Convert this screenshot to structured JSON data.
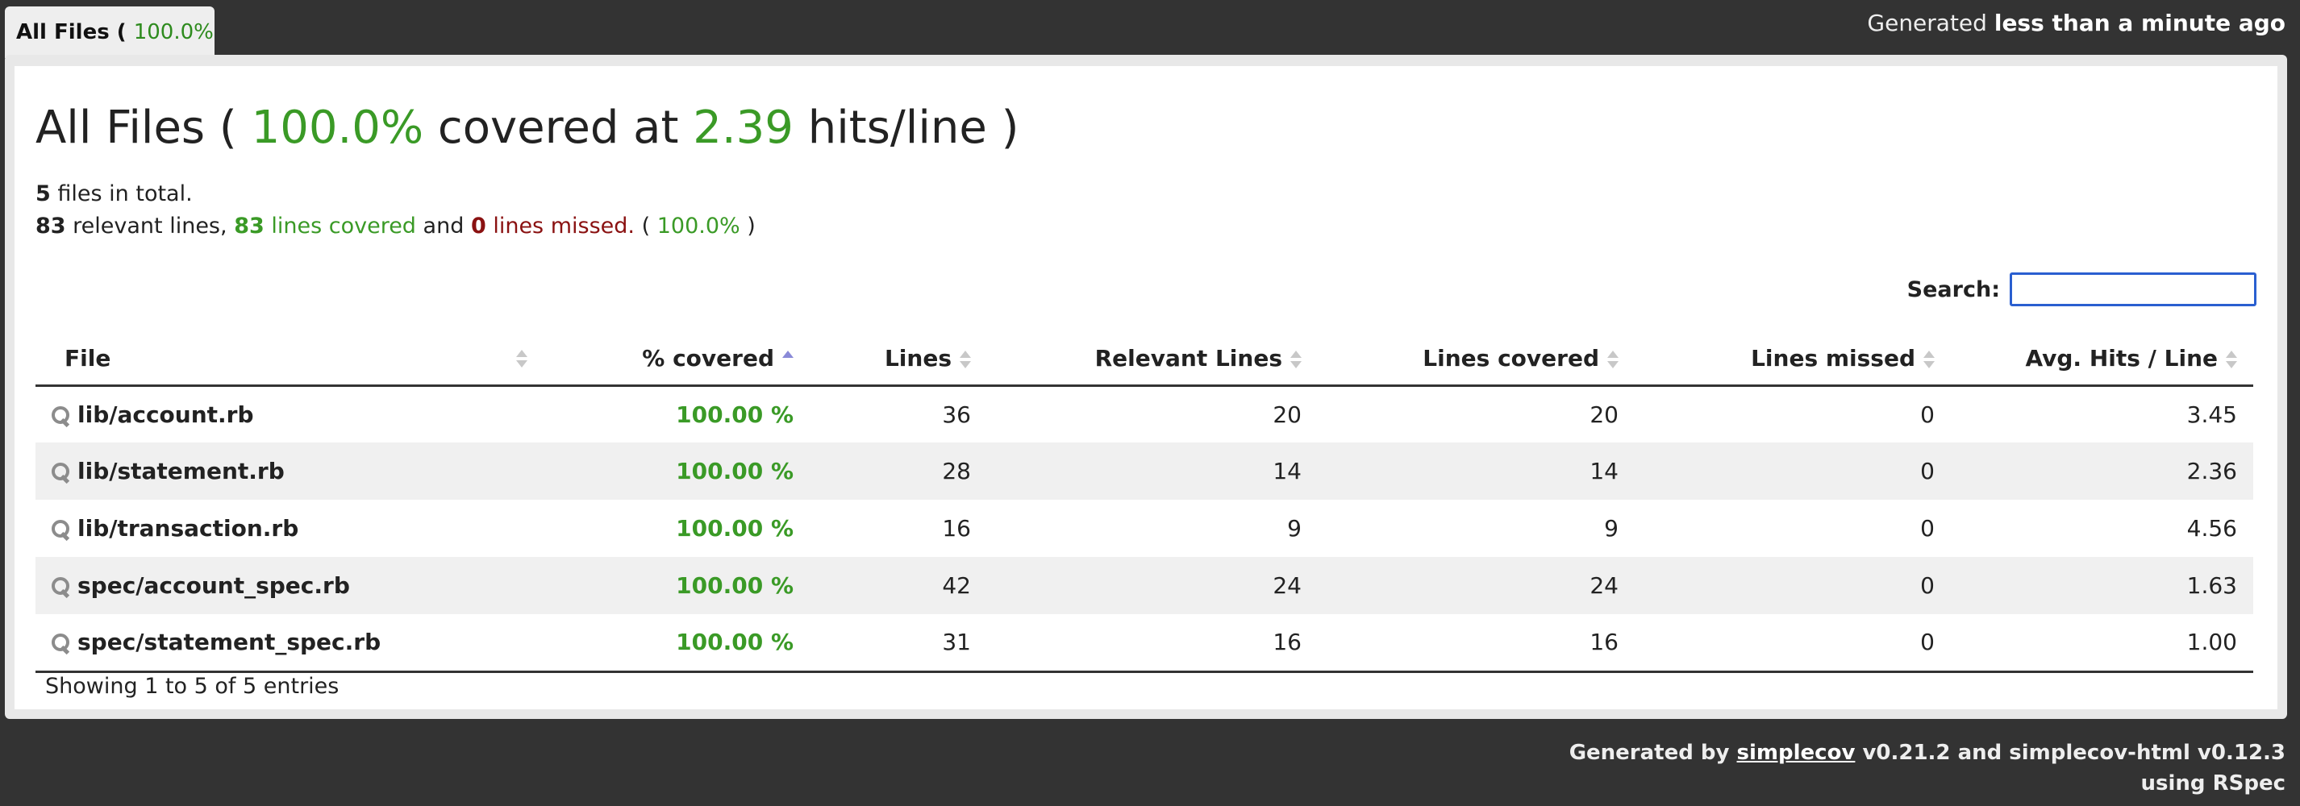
{
  "tab": {
    "name": "All Files",
    "open": "(",
    "percent": "100.0%",
    "close": ")"
  },
  "generated": {
    "prefix": "Generated",
    "when": "less than a minute ago"
  },
  "heading": {
    "title": "All Files (",
    "percent": "100.0%",
    "mid": "covered at",
    "hits": "2.39",
    "suffix": "hits/line )"
  },
  "summary": {
    "files_count": "5",
    "files_text": "files in total.",
    "relevant_count": "83",
    "relevant_text": "relevant lines,",
    "covered_count": "83",
    "covered_text": "lines covered",
    "and_text": "and",
    "missed_count": "0",
    "missed_text": "lines missed.",
    "pct_open": "(",
    "pct": "100.0%",
    "pct_close": ")"
  },
  "search": {
    "label": "Search:",
    "value": ""
  },
  "table": {
    "headers": [
      "File",
      "% covered",
      "Lines",
      "Relevant Lines",
      "Lines covered",
      "Lines missed",
      "Avg. Hits / Line"
    ],
    "rows": [
      {
        "file": "lib/account.rb",
        "pct": "100.00 %",
        "lines": "36",
        "relevant": "20",
        "covered": "20",
        "missed": "0",
        "avg": "3.45"
      },
      {
        "file": "lib/statement.rb",
        "pct": "100.00 %",
        "lines": "28",
        "relevant": "14",
        "covered": "14",
        "missed": "0",
        "avg": "2.36"
      },
      {
        "file": "lib/transaction.rb",
        "pct": "100.00 %",
        "lines": "16",
        "relevant": "9",
        "covered": "9",
        "missed": "0",
        "avg": "4.56"
      },
      {
        "file": "spec/account_spec.rb",
        "pct": "100.00 %",
        "lines": "42",
        "relevant": "24",
        "covered": "24",
        "missed": "0",
        "avg": "1.63"
      },
      {
        "file": "spec/statement_spec.rb",
        "pct": "100.00 %",
        "lines": "31",
        "relevant": "16",
        "covered": "16",
        "missed": "0",
        "avg": "1.00"
      }
    ]
  },
  "info": "Showing 1 to 5 of 5 entries",
  "footer": {
    "prefix": "Generated by",
    "link": "simplecov",
    "middle": "v0.21.2 and simplecov-html v0.12.3",
    "line2": "using RSpec"
  }
}
